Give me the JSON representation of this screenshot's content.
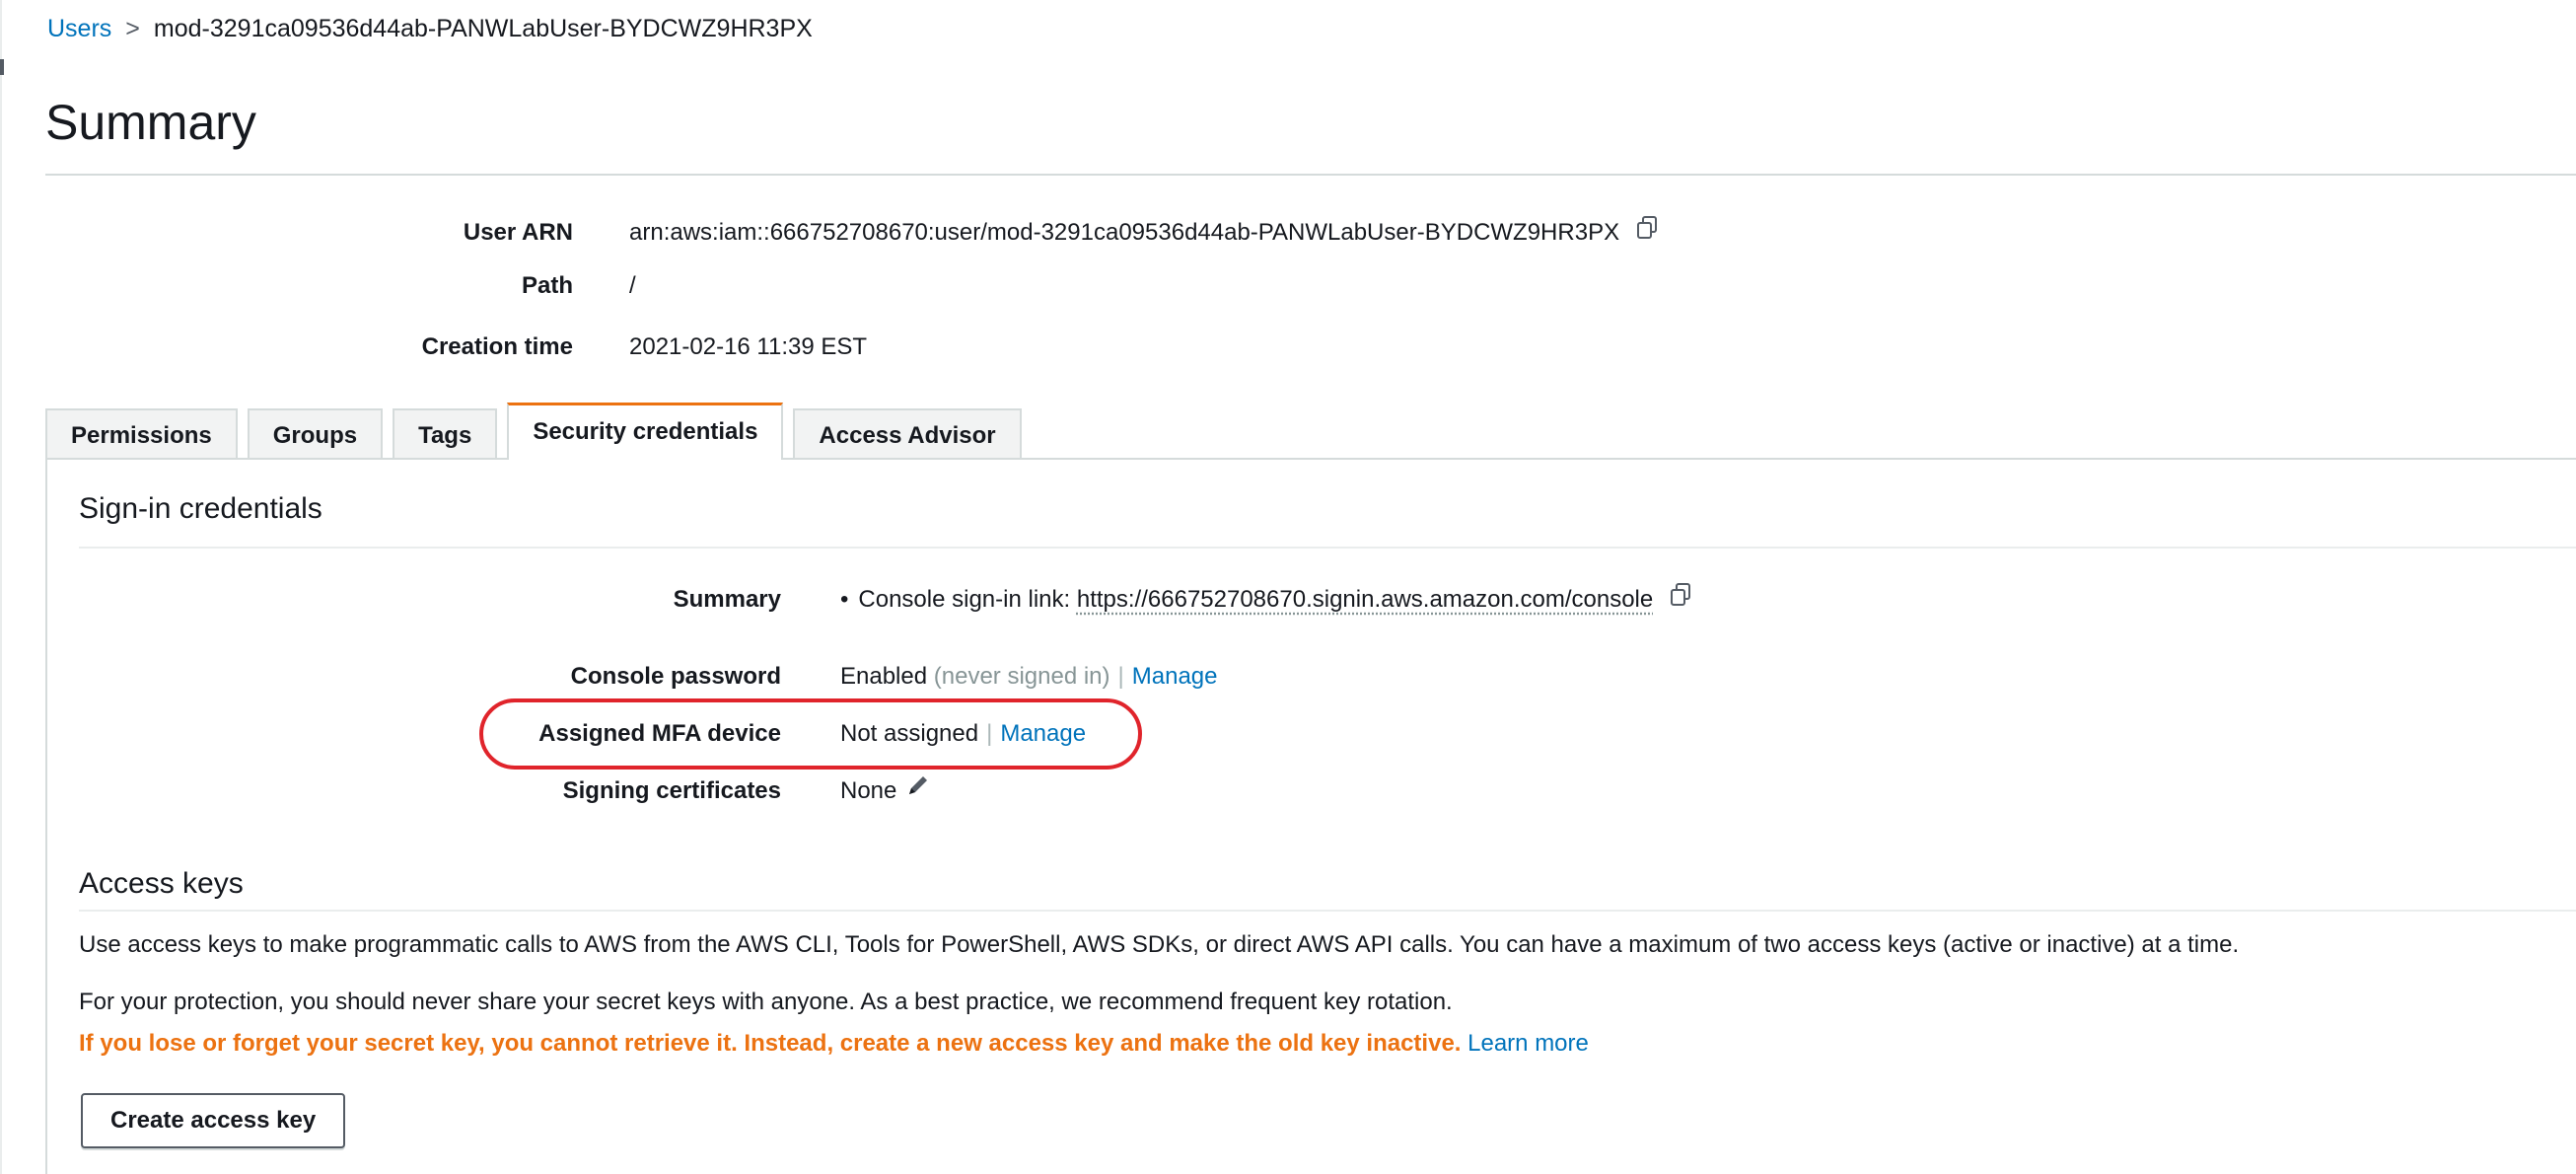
{
  "breadcrumb": {
    "parent": "Users",
    "separator": ">",
    "current": "mod-3291ca09536d44ab-PANWLabUser-BYDCWZ9HR3PX"
  },
  "page_title": "Summary",
  "summary": {
    "user_arn": {
      "label": "User ARN",
      "value": "arn:aws:iam::666752708670:user/mod-3291ca09536d44ab-PANWLabUser-BYDCWZ9HR3PX",
      "icon": "copy-icon"
    },
    "path": {
      "label": "Path",
      "value": "/"
    },
    "creation_time": {
      "label": "Creation time",
      "value": "2021-02-16 11:39 EST"
    }
  },
  "tabs": [
    {
      "label": "Permissions",
      "active": false
    },
    {
      "label": "Groups",
      "active": false
    },
    {
      "label": "Tags",
      "active": false
    },
    {
      "label": "Security credentials",
      "active": true
    },
    {
      "label": "Access Advisor",
      "active": false
    }
  ],
  "signin": {
    "heading": "Sign-in credentials",
    "summary": {
      "label": "Summary",
      "bullet": "•",
      "text": "Console sign-in link:",
      "link": "https://666752708670.signin.aws.amazon.com/console",
      "icon": "copy-icon"
    },
    "console_password": {
      "label": "Console password",
      "status": "Enabled",
      "note": "(never signed in)",
      "separator": "|",
      "action": "Manage"
    },
    "mfa": {
      "label": "Assigned MFA device",
      "status": "Not assigned",
      "separator": "|",
      "action": "Manage"
    },
    "signing_certificates": {
      "label": "Signing certificates",
      "value": "None",
      "icon": "pencil-icon"
    }
  },
  "access_keys": {
    "heading": "Access keys",
    "description": "Use access keys to make programmatic calls to AWS from the AWS CLI, Tools for PowerShell, AWS SDKs, or direct AWS API calls. You can have a maximum of two access keys (active or inactive) at a time.",
    "protection_note": "For your protection, you should never share your secret keys with anyone. As a best practice, we recommend frequent key rotation.",
    "warning": "If you lose or forget your secret key, you cannot retrieve it. Instead, create a new access key and make the old key inactive.",
    "learn_more": "Learn more",
    "create_button": "Create access key"
  },
  "colors": {
    "link": "#0073bb",
    "tab_active_accent": "#ec7211",
    "warning": "#ec7211",
    "highlight_annotation": "#e0242b"
  }
}
